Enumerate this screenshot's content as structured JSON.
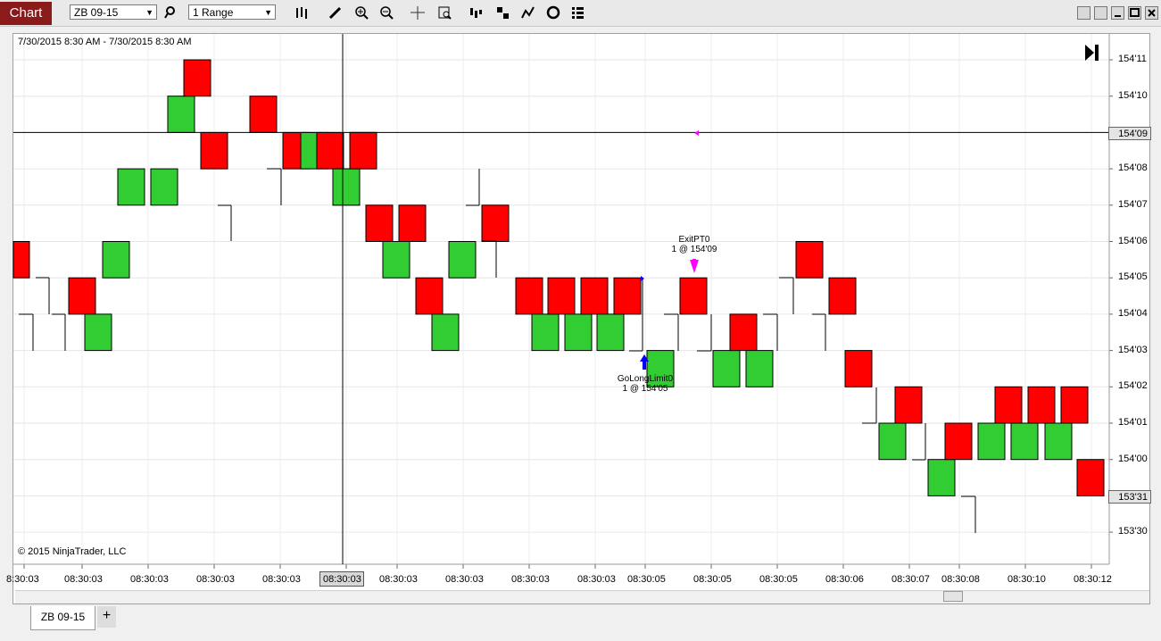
{
  "toolbar": {
    "chart_tab": "Chart",
    "instrument": "ZB 09-15",
    "bar_type": "1 Range"
  },
  "chart": {
    "range_label": "7/30/2015 8:30 AM - 7/30/2015 8:30 AM",
    "copyright": "© 2015 NinjaTrader, LLC",
    "price_labels": [
      "154'11",
      "154'10",
      "154'09",
      "154'08",
      "154'07",
      "154'06",
      "154'05",
      "154'04",
      "154'03",
      "154'02",
      "154'01",
      "154'00",
      "153'31",
      "153'30"
    ],
    "current_price_tag": "154'09",
    "last_price_tag": "153'31",
    "time_labels": [
      "8:30:03",
      "08:30:03",
      "08:30:03",
      "08:30:03",
      "08:30:03",
      "08:30:03",
      "08:30:03",
      "08:30:03",
      "08:30:03",
      "08:30:03",
      "08:30:05",
      "08:30:05",
      "08:30:05",
      "08:30:06",
      "08:30:07",
      "08:30:08",
      "08:30:10",
      "08:30:12"
    ],
    "crosshair_time": "08:30:03",
    "annotations": {
      "exit_name": "ExitPT0",
      "exit_detail": "1 @ 154'09",
      "entry_name": "GoLongLimit0",
      "entry_detail": "1 @ 154'05"
    },
    "colors": {
      "up": "#32cd32",
      "down": "#ff0000",
      "exit_marker": "#ff00ff",
      "entry_marker": "#0000ff"
    }
  },
  "bottom": {
    "tab_label": "ZB 09-15",
    "add_tab": "+"
  },
  "chart_data": {
    "type": "range-bar",
    "instrument": "ZB 09-15",
    "unit": "1/32 of a point (154'05 = 154 + 5/32)",
    "bars": [
      {
        "dir": "down",
        "open": "154'06",
        "close": "154'05"
      },
      {
        "dir": "down",
        "open": "154'05",
        "close": "154'04"
      },
      {
        "dir": "up",
        "open": "154'03",
        "close": "154'04"
      },
      {
        "dir": "up",
        "open": "154'05",
        "close": "154'06"
      },
      {
        "dir": "up",
        "open": "154'07",
        "close": "154'08"
      },
      {
        "dir": "up",
        "open": "154'07",
        "close": "154'08"
      },
      {
        "dir": "up",
        "open": "154'09",
        "close": "154'10"
      },
      {
        "dir": "down",
        "open": "154'11",
        "close": "154'10"
      },
      {
        "dir": "down",
        "open": "154'09",
        "close": "154'08"
      },
      {
        "dir": "down",
        "open": "154'09",
        "close": "154'08"
      },
      {
        "dir": "up",
        "open": "154'08",
        "close": "154'09"
      },
      {
        "dir": "down",
        "open": "154'10",
        "close": "154'09"
      },
      {
        "dir": "down",
        "open": "154'09",
        "close": "154'08"
      },
      {
        "dir": "up",
        "open": "154'07",
        "close": "154'08"
      },
      {
        "dir": "down",
        "open": "154'09",
        "close": "154'08"
      },
      {
        "dir": "up",
        "open": "154'07",
        "close": "154'08"
      },
      {
        "dir": "down",
        "open": "154'09",
        "close": "154'08"
      },
      {
        "dir": "down",
        "open": "154'07",
        "close": "154'06"
      },
      {
        "dir": "up",
        "open": "154'05",
        "close": "154'06"
      },
      {
        "dir": "down",
        "open": "154'07",
        "close": "154'06"
      },
      {
        "dir": "down",
        "open": "154'05",
        "close": "154'04"
      },
      {
        "dir": "up",
        "open": "154'03",
        "close": "154'04"
      },
      {
        "dir": "up",
        "open": "154'05",
        "close": "154'06"
      },
      {
        "dir": "down",
        "open": "154'07",
        "close": "154'06"
      },
      {
        "dir": "down",
        "open": "154'05",
        "close": "154'04"
      },
      {
        "dir": "up",
        "open": "154'03",
        "close": "154'04"
      },
      {
        "dir": "down",
        "open": "154'05",
        "close": "154'04"
      },
      {
        "dir": "up",
        "open": "154'03",
        "close": "154'04"
      },
      {
        "dir": "down",
        "open": "154'05",
        "close": "154'04"
      },
      {
        "dir": "up",
        "open": "154'03",
        "close": "154'04"
      },
      {
        "dir": "down",
        "open": "154'05",
        "close": "154'04"
      },
      {
        "dir": "up",
        "open": "154'02",
        "close": "154'03"
      },
      {
        "dir": "down",
        "open": "154'05",
        "close": "154'04"
      },
      {
        "dir": "up",
        "open": "154'02",
        "close": "154'03"
      },
      {
        "dir": "down",
        "open": "154'04",
        "close": "154'03"
      },
      {
        "dir": "up",
        "open": "154'02",
        "close": "154'03"
      },
      {
        "dir": "down",
        "open": "154'06",
        "close": "154'05"
      },
      {
        "dir": "down",
        "open": "154'05",
        "close": "154'04"
      },
      {
        "dir": "down",
        "open": "154'03",
        "close": "154'02"
      },
      {
        "dir": "up",
        "open": "154'00",
        "close": "154'01"
      },
      {
        "dir": "down",
        "open": "154'02",
        "close": "154'01"
      },
      {
        "dir": "up",
        "open": "153'31",
        "close": "154'00"
      },
      {
        "dir": "down",
        "open": "154'01",
        "close": "154'00"
      },
      {
        "dir": "up",
        "open": "154'00",
        "close": "154'01"
      },
      {
        "dir": "down",
        "open": "154'02",
        "close": "154'01"
      },
      {
        "dir": "up",
        "open": "154'00",
        "close": "154'01"
      },
      {
        "dir": "down",
        "open": "154'02",
        "close": "154'01"
      },
      {
        "dir": "up",
        "open": "154'00",
        "close": "154'01"
      },
      {
        "dir": "down",
        "open": "154'02",
        "close": "154'01"
      },
      {
        "dir": "down",
        "open": "154'00",
        "close": "153'31"
      }
    ],
    "ylim": [
      "153'30",
      "154'11"
    ],
    "grid": true
  }
}
